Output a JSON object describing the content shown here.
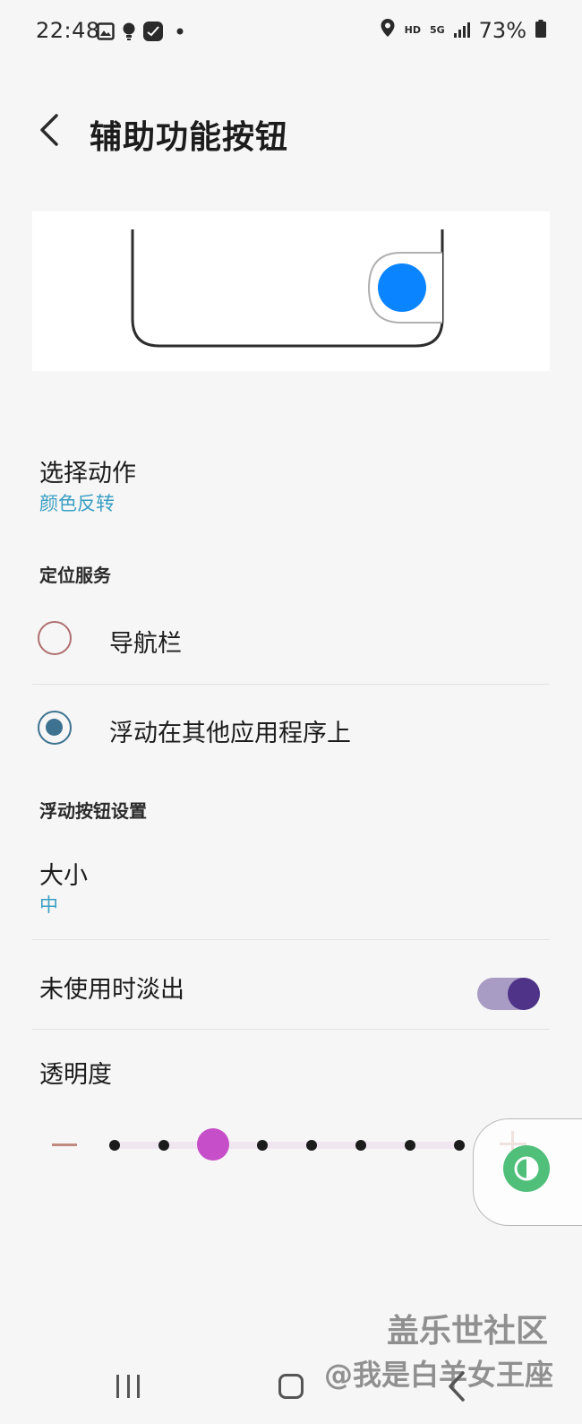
{
  "status_bar": {
    "time": "22:48",
    "network_hd": "HD",
    "network_5g": "5G",
    "battery": "73%",
    "icons": [
      "image-icon",
      "lightbulb-icon",
      "app-badge-icon",
      "notification-dot-icon",
      "location-icon",
      "signal-icon",
      "battery-icon"
    ]
  },
  "header": {
    "title": "辅助功能按钮",
    "back_icon": "chevron-left-icon"
  },
  "action": {
    "title": "选择动作",
    "value": "颜色反转"
  },
  "location_section": {
    "header": "定位服务",
    "options": [
      {
        "label": "导航栏",
        "selected": false
      },
      {
        "label": "浮动在其他应用程序上",
        "selected": true
      }
    ]
  },
  "floating_section": {
    "header": "浮动按钮设置",
    "size_title": "大小",
    "size_value": "中",
    "fade_title": "未使用时淡出",
    "fade_enabled": true,
    "opacity_title": "透明度",
    "opacity_steps": 8,
    "opacity_selected_step": 3
  },
  "colors": {
    "accent_blue": "#0a84ff",
    "subtitle_blue": "#3a9fc4",
    "toggle_on": "#4e3389",
    "slider_thumb": "#c64ec8",
    "float_button": "#4fbf7a"
  },
  "watermark": {
    "line1": "盖乐世社区",
    "line2": "@我是白羊女王座"
  }
}
